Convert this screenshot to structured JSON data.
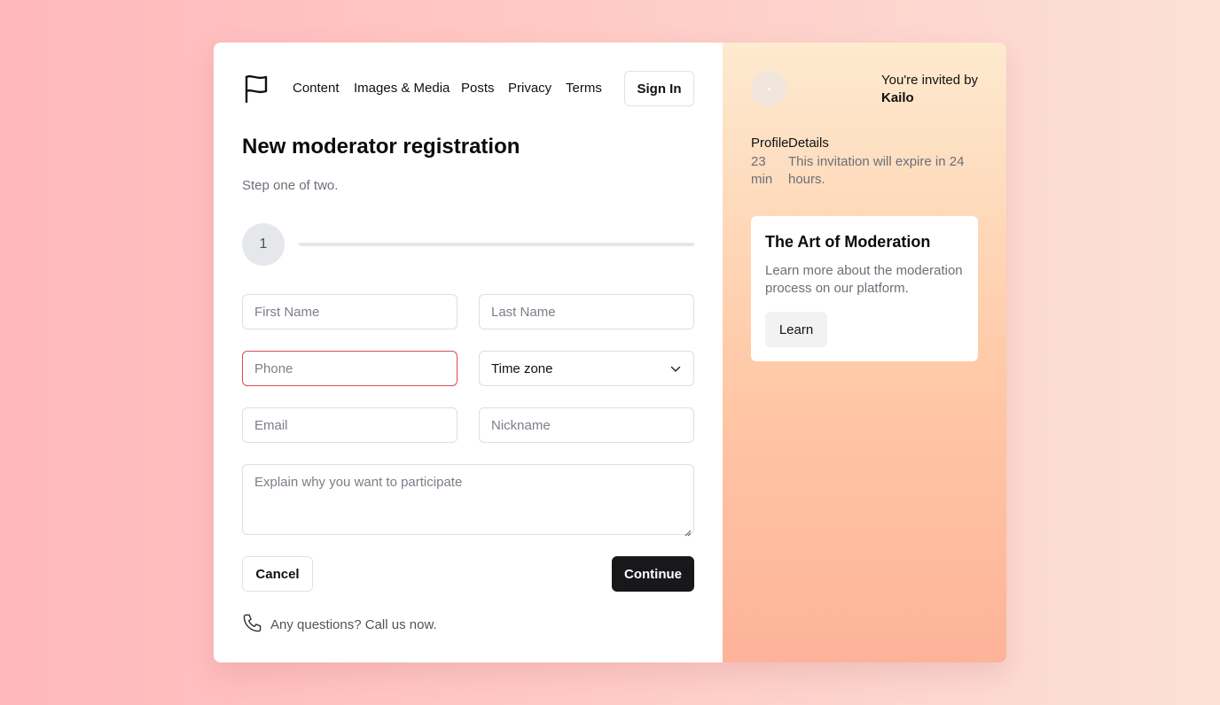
{
  "header": {
    "logo_icon": "flag-icon",
    "nav": [
      "Content",
      "Images & Media",
      "Posts",
      "Privacy",
      "Terms"
    ],
    "sign_in_label": "Sign In"
  },
  "form": {
    "title": "New moderator registration",
    "subtitle": "Step one of two.",
    "step": {
      "current": "1",
      "progress": 0
    },
    "placeholders": {
      "first_name": "First Name",
      "last_name": "Last Name",
      "phone": "Phone",
      "time_zone": "Time zone",
      "email": "Email",
      "nickname": "Nickname",
      "reason": "Explain why you want to participate"
    },
    "cancel_label": "Cancel",
    "continue_label": "Continue",
    "help_icon": "phone-icon",
    "help_text": "Any questions? Call us now.",
    "colors": {
      "error_border": "#d94b57",
      "primary": "#18181b"
    }
  },
  "sidebar": {
    "invited_by_label": "You're invited by",
    "inviter": "Kailo",
    "details": {
      "col1_head": "Profile",
      "col2_head": "Details",
      "time_value": "23",
      "time_unit": "min",
      "expiry_line1": "This invitation will expire in 24",
      "expiry_line2": "hours."
    },
    "card": {
      "title": "The Art of Moderation",
      "text": "Learn more about the moderation process on our platform.",
      "button_label": "Learn"
    }
  }
}
